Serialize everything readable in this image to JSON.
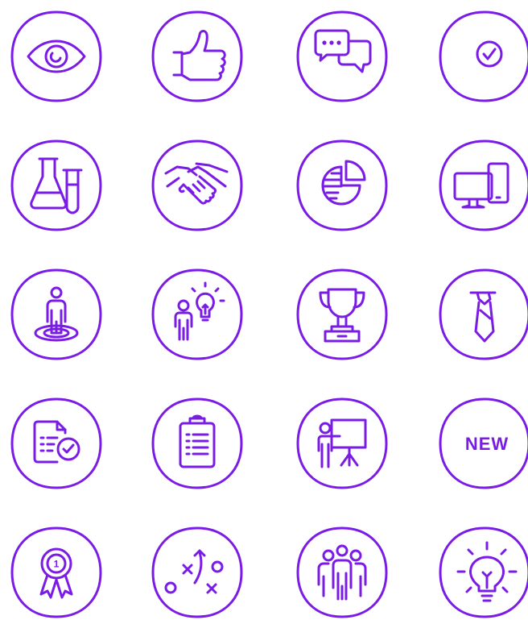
{
  "accent_color": "#7a1ce6",
  "icons": [
    {
      "name": "eye-icon"
    },
    {
      "name": "thumbs-up-icon"
    },
    {
      "name": "chat-bubbles-icon"
    },
    {
      "name": "check-circle-icon"
    },
    {
      "name": "lab-flask-icon"
    },
    {
      "name": "handshake-icon"
    },
    {
      "name": "pie-chart-icon"
    },
    {
      "name": "devices-icon"
    },
    {
      "name": "person-on-target-icon"
    },
    {
      "name": "person-idea-icon"
    },
    {
      "name": "trophy-icon"
    },
    {
      "name": "tie-icon"
    },
    {
      "name": "approved-document-icon"
    },
    {
      "name": "clipboard-icon"
    },
    {
      "name": "presentation-icon"
    },
    {
      "name": "new-badge-icon",
      "label": "NEW"
    },
    {
      "name": "award-ribbon-icon",
      "label": "1"
    },
    {
      "name": "strategy-play-icon"
    },
    {
      "name": "team-icon"
    },
    {
      "name": "light-bulb-icon"
    }
  ]
}
